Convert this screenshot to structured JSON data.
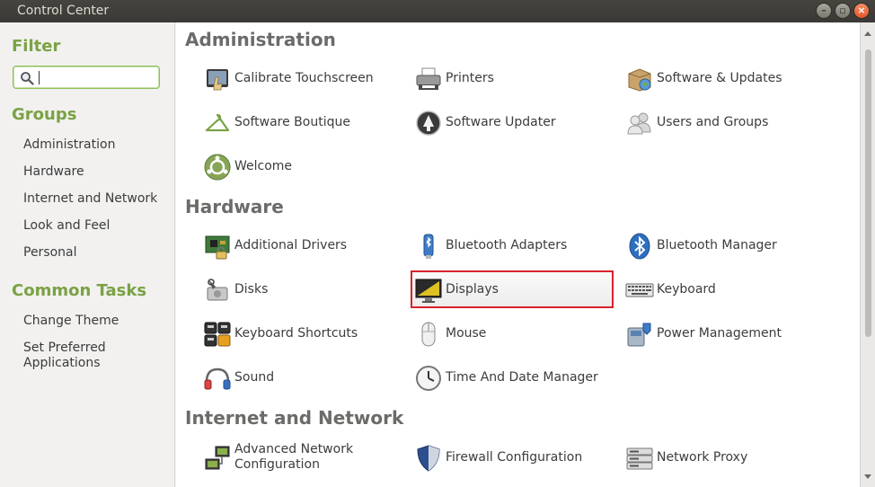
{
  "window": {
    "title": "Control Center"
  },
  "sidebar": {
    "filter_heading": "Filter",
    "search": {
      "value": "",
      "placeholder": ""
    },
    "groups_heading": "Groups",
    "groups": [
      "Administration",
      "Hardware",
      "Internet and Network",
      "Look and Feel",
      "Personal"
    ],
    "tasks_heading": "Common Tasks",
    "tasks": [
      "Change Theme",
      "Set Preferred Applications"
    ]
  },
  "main": {
    "groups": [
      {
        "title": "Administration",
        "items": [
          {
            "label": "Calibrate Touchscreen",
            "icon": "touchscreen-icon"
          },
          {
            "label": "Printers",
            "icon": "printer-icon"
          },
          {
            "label": "Software & Updates",
            "icon": "software-updates-icon"
          },
          {
            "label": "Software Boutique",
            "icon": "hanger-icon"
          },
          {
            "label": "Software Updater",
            "icon": "updater-icon"
          },
          {
            "label": "Users and Groups",
            "icon": "users-icon"
          },
          {
            "label": "Welcome",
            "icon": "welcome-icon"
          }
        ]
      },
      {
        "title": "Hardware",
        "items": [
          {
            "label": "Additional Drivers",
            "icon": "circuit-board-icon"
          },
          {
            "label": "Bluetooth Adapters",
            "icon": "bluetooth-adapter-icon"
          },
          {
            "label": "Bluetooth Manager",
            "icon": "bluetooth-icon"
          },
          {
            "label": "Disks",
            "icon": "disk-icon"
          },
          {
            "label": "Displays",
            "icon": "display-icon",
            "selected": true
          },
          {
            "label": "Keyboard",
            "icon": "keyboard-icon"
          },
          {
            "label": "Keyboard Shortcuts",
            "icon": "shortcuts-icon"
          },
          {
            "label": "Mouse",
            "icon": "mouse-icon"
          },
          {
            "label": "Power Management",
            "icon": "power-icon"
          },
          {
            "label": "Sound",
            "icon": "sound-icon"
          },
          {
            "label": "Time And Date Manager",
            "icon": "clock-icon"
          }
        ]
      },
      {
        "title": "Internet and Network",
        "items": [
          {
            "label": "Advanced Network Configuration",
            "icon": "network-icon"
          },
          {
            "label": "Firewall Configuration",
            "icon": "firewall-icon"
          },
          {
            "label": "Network Proxy",
            "icon": "proxy-icon"
          }
        ]
      }
    ]
  },
  "colors": {
    "accent": "#7aa244",
    "selection_border": "#d8222b",
    "titlebar": "#3c3b37"
  }
}
